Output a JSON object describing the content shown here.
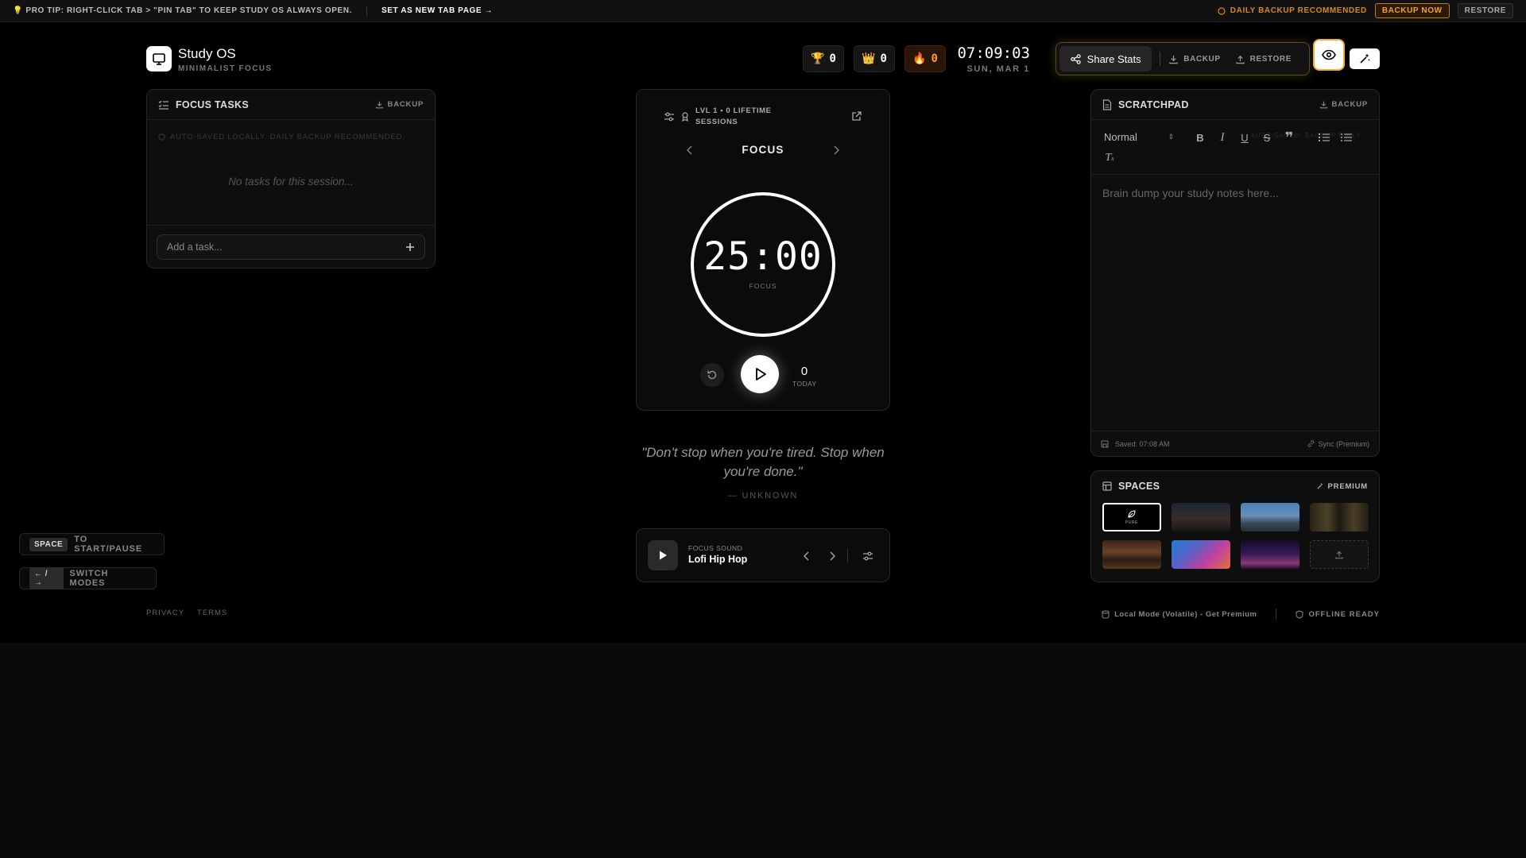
{
  "banner": {
    "tip": "💡 PRO TIP: RIGHT-CLICK TAB > \"PIN TAB\" TO KEEP STUDY OS ALWAYS OPEN.",
    "new_tab": "SET AS NEW TAB PAGE →",
    "warning": "DAILY BACKUP RECOMMENDED",
    "backup_now": "BACKUP NOW",
    "restore": "RESTORE"
  },
  "brand": {
    "title": "Study OS",
    "subtitle": "MINIMALIST FOCUS"
  },
  "stats": {
    "trophies": "0",
    "crowns": "0",
    "streak": "0"
  },
  "clock": {
    "time": "07:09:03",
    "date": "SUN, MAR 1"
  },
  "actions": {
    "share": "Share Stats",
    "backup": "BACKUP",
    "restore": "RESTORE"
  },
  "tasks": {
    "title": "FOCUS TASKS",
    "backup": "BACKUP",
    "note": "AUTO-SAVED LOCALLY. DAILY BACKUP RECOMMENDED.",
    "empty": "No tasks for this session...",
    "placeholder": "Add a task..."
  },
  "timer": {
    "level": "LVL 1 • 0 LIFETIME SESSIONS",
    "mode": "FOCUS",
    "time": "25:00",
    "sub": "FOCUS",
    "today_count": "0",
    "today_label": "TODAY"
  },
  "quote": {
    "text": "\"Don't stop when you're tired. Stop when you're done.\"",
    "author": "— UNKNOWN"
  },
  "player": {
    "label": "FOCUS SOUND",
    "name": "Lofi Hip Hop"
  },
  "scratchpad": {
    "title": "SCRATCHPAD",
    "backup": "BACKUP",
    "format": "Normal",
    "ghost": "AUTO-SAVED. BACKUP DAILY.",
    "placeholder": "Brain dump your study notes here...",
    "saved": "Saved: 07:08 AM",
    "sync": "Sync (Premium)"
  },
  "spaces": {
    "title": "SPACES",
    "premium": "PREMIUM",
    "pure_label": "PURE"
  },
  "hints": {
    "space_key": "SPACE",
    "space_text": "TO START/PAUSE",
    "arrows_key": "← / →",
    "arrows_text": "SWITCH MODES"
  },
  "footer": {
    "privacy": "PRIVACY",
    "terms": "TERMS",
    "local_mode": "Local Mode (Volatile) - Get Premium",
    "offline": "OFFLINE READY"
  },
  "colors": {
    "accent": "#f0a030",
    "streak": "#ff9a3c",
    "background": "#000000"
  }
}
